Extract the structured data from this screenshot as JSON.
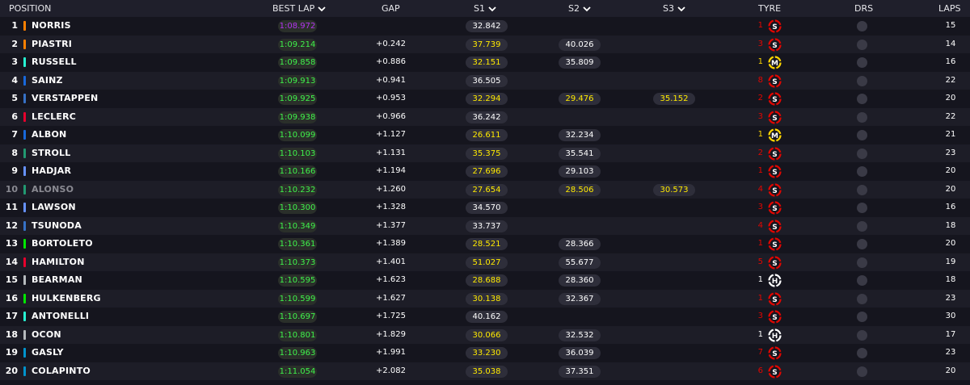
{
  "header": {
    "position": "POSITION",
    "best_lap": "BEST LAP",
    "gap": "GAP",
    "s1": "S1",
    "s2": "S2",
    "s3": "S3",
    "tyre": "TYRE",
    "drs": "DRS",
    "laps": "LAPS"
  },
  "colors": {
    "background": "#15151e",
    "header_bg": "#1f1f2b",
    "purple": "#b335f0",
    "green": "#3ff24b",
    "yellow": "#ffea00",
    "soft": "#e10600",
    "medium": "#ffd600",
    "hard": "#ffffff"
  },
  "rows": [
    {
      "pos": "1",
      "driver": "NORRIS",
      "team_color": "#ff8000",
      "best_lap": "1:08.972",
      "best_color": "purple",
      "gap": "",
      "s1": "32.842",
      "s1_color": "white",
      "s2": "",
      "s2_color": "white",
      "s3": "",
      "s3_color": "white",
      "tyre_laps": "1",
      "tyre": "S",
      "tyre_laps_color": "red",
      "laps": "15"
    },
    {
      "pos": "2",
      "driver": "PIASTRI",
      "team_color": "#ff8000",
      "best_lap": "1:09.214",
      "best_color": "green",
      "gap": "+0.242",
      "s1": "37.739",
      "s1_color": "yellow",
      "s2": "40.026",
      "s2_color": "white",
      "s3": "",
      "s3_color": "white",
      "tyre_laps": "3",
      "tyre": "S",
      "tyre_laps_color": "red",
      "laps": "14"
    },
    {
      "pos": "3",
      "driver": "RUSSELL",
      "team_color": "#27f4d2",
      "best_lap": "1:09.858",
      "best_color": "green",
      "gap": "+0.886",
      "s1": "32.151",
      "s1_color": "yellow",
      "s2": "35.809",
      "s2_color": "white",
      "s3": "",
      "s3_color": "white",
      "tyre_laps": "1",
      "tyre": "M",
      "tyre_laps_color": "yellow",
      "laps": "16"
    },
    {
      "pos": "4",
      "driver": "SAINZ",
      "team_color": "#1868db",
      "best_lap": "1:09.913",
      "best_color": "green",
      "gap": "+0.941",
      "s1": "36.505",
      "s1_color": "white",
      "s2": "",
      "s2_color": "white",
      "s3": "",
      "s3_color": "white",
      "tyre_laps": "8",
      "tyre": "S",
      "tyre_laps_color": "red",
      "laps": "22"
    },
    {
      "pos": "5",
      "driver": "VERSTAPPEN",
      "team_color": "#3671c6",
      "best_lap": "1:09.925",
      "best_color": "green",
      "gap": "+0.953",
      "s1": "32.294",
      "s1_color": "yellow",
      "s2": "29.476",
      "s2_color": "yellow",
      "s3": "35.152",
      "s3_color": "yellow",
      "tyre_laps": "2",
      "tyre": "S",
      "tyre_laps_color": "red",
      "laps": "20"
    },
    {
      "pos": "6",
      "driver": "LECLERC",
      "team_color": "#e8002d",
      "best_lap": "1:09.938",
      "best_color": "green",
      "gap": "+0.966",
      "s1": "36.242",
      "s1_color": "white",
      "s2": "",
      "s2_color": "white",
      "s3": "",
      "s3_color": "white",
      "tyre_laps": "3",
      "tyre": "S",
      "tyre_laps_color": "red",
      "laps": "22"
    },
    {
      "pos": "7",
      "driver": "ALBON",
      "team_color": "#1868db",
      "best_lap": "1:10.099",
      "best_color": "green",
      "gap": "+1.127",
      "s1": "26.611",
      "s1_color": "yellow",
      "s2": "32.234",
      "s2_color": "white",
      "s3": "",
      "s3_color": "white",
      "tyre_laps": "1",
      "tyre": "M",
      "tyre_laps_color": "yellow",
      "laps": "21"
    },
    {
      "pos": "8",
      "driver": "STROLL",
      "team_color": "#229971",
      "best_lap": "1:10.103",
      "best_color": "green",
      "gap": "+1.131",
      "s1": "35.375",
      "s1_color": "yellow",
      "s2": "35.541",
      "s2_color": "white",
      "s3": "",
      "s3_color": "white",
      "tyre_laps": "2",
      "tyre": "S",
      "tyre_laps_color": "red",
      "laps": "23"
    },
    {
      "pos": "9",
      "driver": "HADJAR",
      "team_color": "#6692ff",
      "best_lap": "1:10.166",
      "best_color": "green",
      "gap": "+1.194",
      "s1": "27.696",
      "s1_color": "yellow",
      "s2": "29.103",
      "s2_color": "white",
      "s3": "",
      "s3_color": "white",
      "tyre_laps": "1",
      "tyre": "S",
      "tyre_laps_color": "red",
      "laps": "20"
    },
    {
      "pos": "10",
      "driver": "ALONSO",
      "team_color": "#229971",
      "best_lap": "1:10.232",
      "best_color": "green",
      "gap": "+1.260",
      "s1": "27.654",
      "s1_color": "yellow",
      "s2": "28.506",
      "s2_color": "yellow",
      "s3": "30.573",
      "s3_color": "yellow",
      "tyre_laps": "4",
      "tyre": "S",
      "tyre_laps_color": "red",
      "laps": "20",
      "dim": true
    },
    {
      "pos": "11",
      "driver": "LAWSON",
      "team_color": "#6692ff",
      "best_lap": "1:10.300",
      "best_color": "green",
      "gap": "+1.328",
      "s1": "34.570",
      "s1_color": "white",
      "s2": "",
      "s2_color": "white",
      "s3": "",
      "s3_color": "white",
      "tyre_laps": "3",
      "tyre": "S",
      "tyre_laps_color": "red",
      "laps": "16"
    },
    {
      "pos": "12",
      "driver": "TSUNODA",
      "team_color": "#3671c6",
      "best_lap": "1:10.349",
      "best_color": "green",
      "gap": "+1.377",
      "s1": "33.737",
      "s1_color": "white",
      "s2": "",
      "s2_color": "white",
      "s3": "",
      "s3_color": "white",
      "tyre_laps": "4",
      "tyre": "S",
      "tyre_laps_color": "red",
      "laps": "18"
    },
    {
      "pos": "13",
      "driver": "BORTOLETO",
      "team_color": "#00e700",
      "best_lap": "1:10.361",
      "best_color": "green",
      "gap": "+1.389",
      "s1": "28.521",
      "s1_color": "yellow",
      "s2": "28.366",
      "s2_color": "white",
      "s3": "",
      "s3_color": "white",
      "tyre_laps": "1",
      "tyre": "S",
      "tyre_laps_color": "red",
      "laps": "20"
    },
    {
      "pos": "14",
      "driver": "HAMILTON",
      "team_color": "#e8002d",
      "best_lap": "1:10.373",
      "best_color": "green",
      "gap": "+1.401",
      "s1": "51.027",
      "s1_color": "yellow",
      "s2": "55.677",
      "s2_color": "white",
      "s3": "",
      "s3_color": "white",
      "tyre_laps": "5",
      "tyre": "S",
      "tyre_laps_color": "red",
      "laps": "19"
    },
    {
      "pos": "15",
      "driver": "BEARMAN",
      "team_color": "#b6babd",
      "best_lap": "1:10.595",
      "best_color": "green",
      "gap": "+1.623",
      "s1": "28.688",
      "s1_color": "yellow",
      "s2": "28.360",
      "s2_color": "white",
      "s3": "",
      "s3_color": "white",
      "tyre_laps": "1",
      "tyre": "H",
      "tyre_laps_color": "white",
      "laps": "18"
    },
    {
      "pos": "16",
      "driver": "HULKENBERG",
      "team_color": "#00e700",
      "best_lap": "1:10.599",
      "best_color": "green",
      "gap": "+1.627",
      "s1": "30.138",
      "s1_color": "yellow",
      "s2": "32.367",
      "s2_color": "white",
      "s3": "",
      "s3_color": "white",
      "tyre_laps": "1",
      "tyre": "S",
      "tyre_laps_color": "red",
      "laps": "23"
    },
    {
      "pos": "17",
      "driver": "ANTONELLI",
      "team_color": "#27f4d2",
      "best_lap": "1:10.697",
      "best_color": "green",
      "gap": "+1.725",
      "s1": "40.162",
      "s1_color": "white",
      "s2": "",
      "s2_color": "white",
      "s3": "",
      "s3_color": "white",
      "tyre_laps": "3",
      "tyre": "S",
      "tyre_laps_color": "red",
      "laps": "30"
    },
    {
      "pos": "18",
      "driver": "OCON",
      "team_color": "#b6babd",
      "best_lap": "1:10.801",
      "best_color": "green",
      "gap": "+1.829",
      "s1": "30.066",
      "s1_color": "yellow",
      "s2": "32.532",
      "s2_color": "white",
      "s3": "",
      "s3_color": "white",
      "tyre_laps": "1",
      "tyre": "H",
      "tyre_laps_color": "white",
      "laps": "17"
    },
    {
      "pos": "19",
      "driver": "GASLY",
      "team_color": "#0093cc",
      "best_lap": "1:10.963",
      "best_color": "green",
      "gap": "+1.991",
      "s1": "33.230",
      "s1_color": "yellow",
      "s2": "36.039",
      "s2_color": "white",
      "s3": "",
      "s3_color": "white",
      "tyre_laps": "7",
      "tyre": "S",
      "tyre_laps_color": "red",
      "laps": "23"
    },
    {
      "pos": "20",
      "driver": "COLAPINTO",
      "team_color": "#0093cc",
      "best_lap": "1:11.054",
      "best_color": "green",
      "gap": "+2.082",
      "s1": "35.038",
      "s1_color": "yellow",
      "s2": "37.351",
      "s2_color": "white",
      "s3": "",
      "s3_color": "white",
      "tyre_laps": "6",
      "tyre": "S",
      "tyre_laps_color": "red",
      "laps": "20"
    }
  ]
}
